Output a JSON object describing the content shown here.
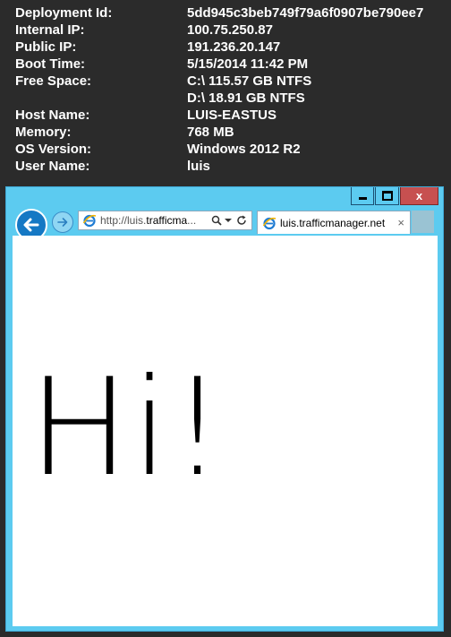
{
  "info": {
    "rows": [
      {
        "label": "Deployment Id:",
        "value": "5dd945c3beb749f79a6f0907be790ee7"
      },
      {
        "label": "Internal IP:",
        "value": "100.75.250.87"
      },
      {
        "label": "Public IP:",
        "value": "191.236.20.147"
      },
      {
        "label": "Boot Time:",
        "value": "5/15/2014 11:42 PM"
      },
      {
        "label": "Free Space:",
        "value": "C:\\ 115.57 GB NTFS"
      },
      {
        "label": "",
        "value": "D:\\ 18.91 GB NTFS"
      },
      {
        "label": "Host Name:",
        "value": "LUIS-EASTUS"
      },
      {
        "label": "Memory:",
        "value": "768 MB"
      },
      {
        "label": "OS Version:",
        "value": "Windows 2012 R2"
      },
      {
        "label": "User Name:",
        "value": "luis"
      }
    ]
  },
  "browser": {
    "close_label": "x",
    "address_prefix": "http://luis.",
    "address_highlight": "trafficma",
    "address_suffix": "...",
    "tab_title": "luis.trafficmanager.net",
    "tab_close": "×",
    "page_text": "Hi!"
  },
  "colors": {
    "desktop_bg": "#2b2b2b",
    "window_frame": "#5ccbf0",
    "close_button": "#c75050",
    "back_button": "#1578c4"
  }
}
